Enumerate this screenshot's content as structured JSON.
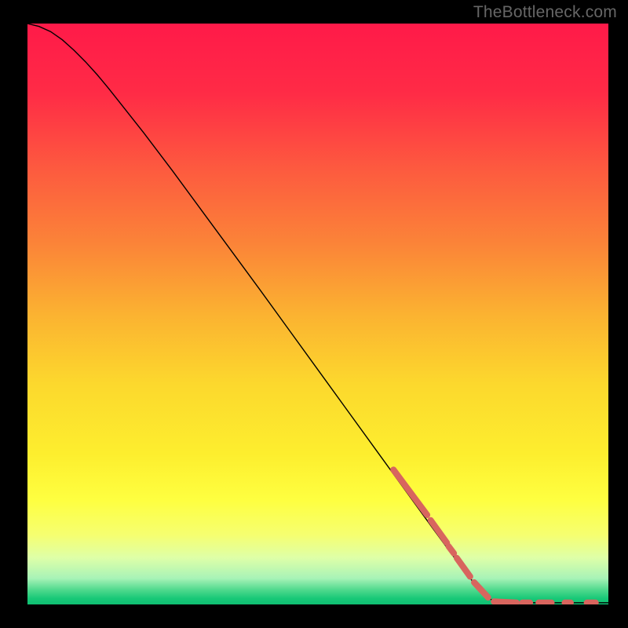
{
  "watermark": "TheBottleneck.com",
  "chart_data": {
    "type": "line",
    "title": "",
    "xlabel": "",
    "ylabel": "",
    "xlim": [
      0,
      100
    ],
    "ylim": [
      0,
      100
    ],
    "background_gradient": {
      "stops": [
        {
          "offset": 0.0,
          "color": "#ff1a49"
        },
        {
          "offset": 0.12,
          "color": "#ff2b46"
        },
        {
          "offset": 0.25,
          "color": "#fd5a3f"
        },
        {
          "offset": 0.38,
          "color": "#fb8438"
        },
        {
          "offset": 0.5,
          "color": "#fbb231"
        },
        {
          "offset": 0.62,
          "color": "#fcd82d"
        },
        {
          "offset": 0.74,
          "color": "#fdee2e"
        },
        {
          "offset": 0.82,
          "color": "#feff40"
        },
        {
          "offset": 0.88,
          "color": "#f6ff70"
        },
        {
          "offset": 0.92,
          "color": "#deffa8"
        },
        {
          "offset": 0.955,
          "color": "#a8f3b7"
        },
        {
          "offset": 0.975,
          "color": "#4fd98d"
        },
        {
          "offset": 0.99,
          "color": "#17c877"
        },
        {
          "offset": 1.0,
          "color": "#0fbf72"
        }
      ]
    },
    "series": [
      {
        "name": "curve",
        "stroke": "#000000",
        "stroke_width": 1.4,
        "points": [
          {
            "x": 0.0,
            "y": 100.0
          },
          {
            "x": 2.0,
            "y": 99.5
          },
          {
            "x": 4.0,
            "y": 98.6
          },
          {
            "x": 6.0,
            "y": 97.2
          },
          {
            "x": 8.0,
            "y": 95.4
          },
          {
            "x": 10.0,
            "y": 93.4
          },
          {
            "x": 12.0,
            "y": 91.2
          },
          {
            "x": 14.0,
            "y": 88.8
          },
          {
            "x": 20.0,
            "y": 81.2
          },
          {
            "x": 25.0,
            "y": 74.6
          },
          {
            "x": 30.0,
            "y": 67.8
          },
          {
            "x": 35.0,
            "y": 61.0
          },
          {
            "x": 40.0,
            "y": 54.2
          },
          {
            "x": 45.0,
            "y": 47.3
          },
          {
            "x": 50.0,
            "y": 40.4
          },
          {
            "x": 55.0,
            "y": 33.5
          },
          {
            "x": 60.0,
            "y": 26.6
          },
          {
            "x": 65.0,
            "y": 19.7
          },
          {
            "x": 70.0,
            "y": 12.8
          },
          {
            "x": 75.0,
            "y": 6.0
          },
          {
            "x": 78.0,
            "y": 2.3
          },
          {
            "x": 79.5,
            "y": 1.0
          },
          {
            "x": 80.5,
            "y": 0.5
          },
          {
            "x": 82.0,
            "y": 0.3
          },
          {
            "x": 85.0,
            "y": 0.3
          },
          {
            "x": 90.0,
            "y": 0.3
          },
          {
            "x": 95.0,
            "y": 0.3
          },
          {
            "x": 100.0,
            "y": 0.3
          }
        ]
      }
    ],
    "markers": {
      "stroke": "#d8655e",
      "stroke_width": 8,
      "cap": "round",
      "segments": [
        {
          "x1": 63.0,
          "y1": 23.2,
          "x2": 68.8,
          "y2": 15.4
        },
        {
          "x1": 69.4,
          "y1": 14.5,
          "x2": 72.2,
          "y2": 10.6
        },
        {
          "x1": 72.5,
          "y1": 10.0,
          "x2": 73.4,
          "y2": 8.8
        },
        {
          "x1": 73.9,
          "y1": 8.0,
          "x2": 76.2,
          "y2": 4.8
        },
        {
          "x1": 76.9,
          "y1": 3.8,
          "x2": 79.3,
          "y2": 1.2
        },
        {
          "x1": 80.3,
          "y1": 0.5,
          "x2": 84.2,
          "y2": 0.3
        },
        {
          "x1": 85.2,
          "y1": 0.3,
          "x2": 86.5,
          "y2": 0.3
        },
        {
          "x1": 88.0,
          "y1": 0.3,
          "x2": 90.2,
          "y2": 0.3
        },
        {
          "x1": 92.5,
          "y1": 0.3,
          "x2": 93.5,
          "y2": 0.3
        },
        {
          "x1": 96.3,
          "y1": 0.3,
          "x2": 97.8,
          "y2": 0.3
        }
      ]
    }
  }
}
